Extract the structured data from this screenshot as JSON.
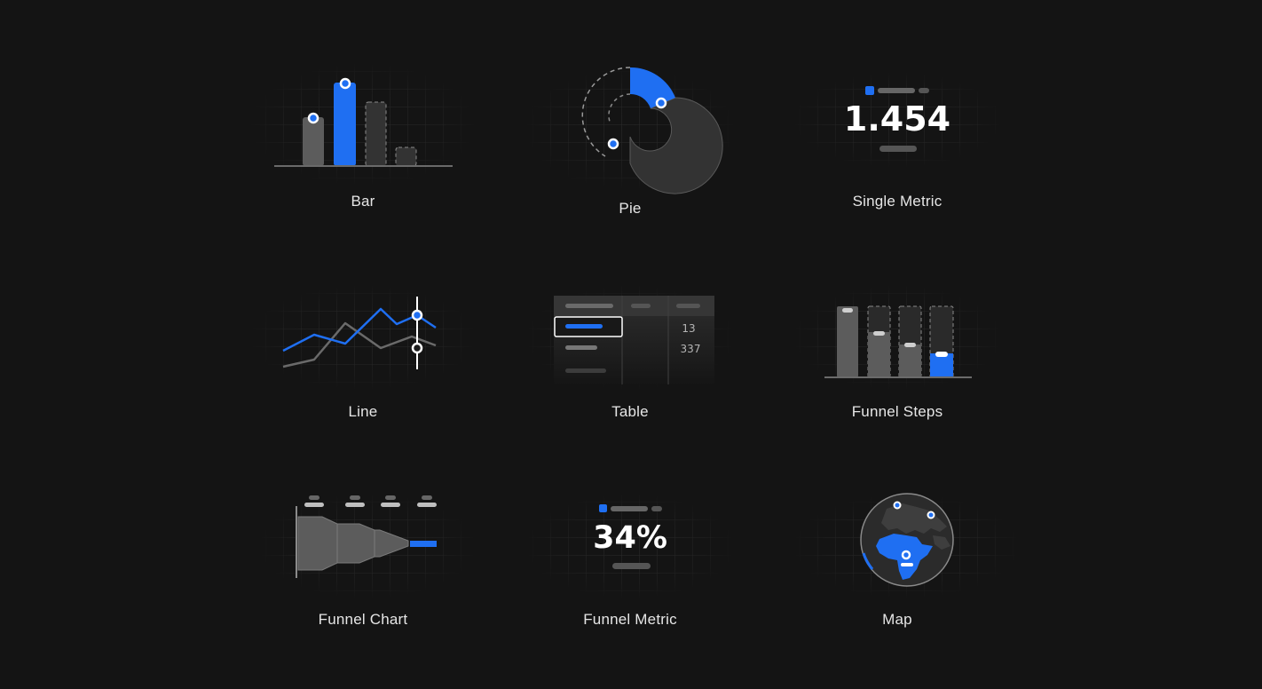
{
  "cards": {
    "bar": {
      "label": "Bar"
    },
    "pie": {
      "label": "Pie"
    },
    "single_metric": {
      "label": "Single Metric",
      "value": "1.454"
    },
    "line": {
      "label": "Line"
    },
    "table": {
      "label": "Table",
      "cell_1": "13",
      "cell_2": "337"
    },
    "funnel_steps": {
      "label": "Funnel Steps"
    },
    "funnel_chart": {
      "label": "Funnel Chart"
    },
    "funnel_metric": {
      "label": "Funnel Metric",
      "value": "34%"
    },
    "map": {
      "label": "Map"
    }
  },
  "colors": {
    "background": "#141414",
    "accent": "#1f6ff2",
    "bar_gray": "#5c5c5c",
    "dark_fill": "#333333",
    "text": "#e6e6e6"
  }
}
